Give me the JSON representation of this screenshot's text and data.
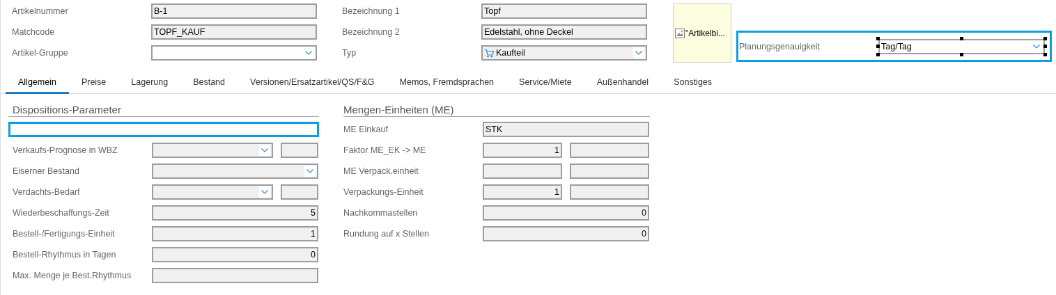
{
  "header": {
    "left_fields": [
      {
        "label": "Artikelnummer",
        "kind": "text",
        "value": "B-1"
      },
      {
        "label": "Matchcode",
        "kind": "text",
        "value": "TOPF_KAUF"
      },
      {
        "label": "Artikel-Gruppe",
        "kind": "combo"
      }
    ],
    "right_fields": [
      {
        "label": "Bezeichnung 1",
        "kind": "text",
        "value": "Topf"
      },
      {
        "label": "Bezeichnung 2",
        "kind": "text",
        "value": "Edelstahl, ohne Deckel"
      },
      {
        "label": "Typ",
        "kind": "combo_icon",
        "value": "Kaufteil"
      }
    ],
    "image_placeholder": {
      "alt_text": "\"Artikelbi..."
    },
    "planning": {
      "label": "Planungsgenauigkeit",
      "value": "Tag/Tag",
      "focused": true,
      "selected": true
    }
  },
  "tabs": [
    {
      "label": "Allgemein",
      "selected": true
    },
    {
      "label": "Preise",
      "selected": false
    },
    {
      "label": "Lagerung",
      "selected": false
    },
    {
      "label": "Bestand",
      "selected": false
    },
    {
      "label": "Versionen/Ersatzartikel/QS/F&G",
      "selected": false
    },
    {
      "label": "Memos, Fremdsprachen",
      "selected": false
    },
    {
      "label": "Service/Miete",
      "selected": false
    },
    {
      "label": "Außenhandel",
      "selected": false
    },
    {
      "label": "Sonstiges",
      "selected": false
    }
  ],
  "sections": [
    {
      "title": "Dispositions-Parameter",
      "rows": [
        {
          "kind": "blank",
          "focused": true
        },
        {
          "label": "Verkaufs-Prognose in WBZ",
          "kind": "combo_pair"
        },
        {
          "label": "Eiserner Bestand",
          "kind": "combo"
        },
        {
          "label": "Verdachts-Bedarf",
          "kind": "combo_pair"
        },
        {
          "label": "Wiederbeschaffungs-Zeit",
          "kind": "number",
          "value": "5"
        },
        {
          "label": "Bestell-/Fertigungs-Einheit",
          "kind": "number",
          "value": "1"
        },
        {
          "label": "Bestell-Rhythmus in Tagen",
          "kind": "number",
          "value": "0"
        },
        {
          "label": "Max. Menge je Best.Rhythmus",
          "kind": "number"
        }
      ]
    },
    {
      "title": "Mengen-Einheiten (ME)",
      "rows": [
        {
          "label": "ME Einkauf",
          "kind": "text",
          "value": "STK"
        },
        {
          "label": "Faktor ME_EK -> ME",
          "kind": "pair",
          "value": "1"
        },
        {
          "label": "ME Verpack.einheit",
          "kind": "pair"
        },
        {
          "label": "Verpackungs-Einheit",
          "kind": "pair",
          "value": "1"
        },
        {
          "label": "Nachkommastellen",
          "kind": "number",
          "value": "0"
        },
        {
          "label": "Rundung auf x Stellen",
          "kind": "number",
          "value": "0"
        }
      ]
    }
  ]
}
